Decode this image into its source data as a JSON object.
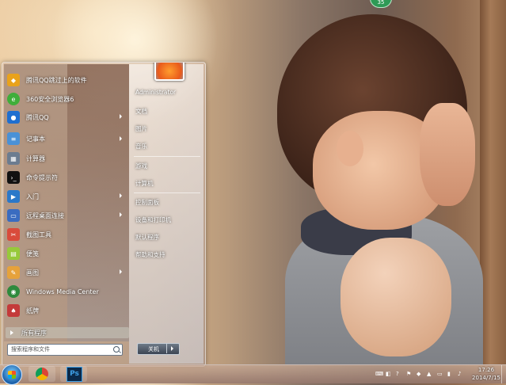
{
  "desktop": {
    "badge": "35"
  },
  "start_menu": {
    "programs": [
      {
        "label": "腾讯QQ跳过上的软件",
        "icon": "qq-icon",
        "color": "#e9a21b"
      },
      {
        "label": "360安全浏览器6",
        "icon": "browser-360-icon",
        "color": "#3fae3a"
      },
      {
        "label": "腾讯QQ",
        "icon": "qq-penguin-icon",
        "color": "#1f6fd0"
      },
      {
        "label": "记事本",
        "icon": "notepad-icon",
        "color": "#4a91d6"
      },
      {
        "label": "计算器",
        "icon": "calculator-icon",
        "color": "#6b7c90"
      },
      {
        "label": "命令提示符",
        "icon": "cmd-icon",
        "color": "#111111"
      },
      {
        "label": "入门",
        "icon": "getting-started-icon",
        "color": "#2b78c9"
      },
      {
        "label": "远程桌面连接",
        "icon": "remote-desktop-icon",
        "color": "#3a6cc0"
      },
      {
        "label": "截图工具",
        "icon": "snipping-tool-icon",
        "color": "#d94b3b"
      },
      {
        "label": "便笺",
        "icon": "sticky-notes-icon",
        "color": "#97c93a"
      },
      {
        "label": "画图",
        "icon": "paint-icon",
        "color": "#e6a23b"
      },
      {
        "label": "Windows Media Center",
        "icon": "media-center-icon",
        "color": "#2f8a3d"
      },
      {
        "label": "纸牌",
        "icon": "solitaire-icon",
        "color": "#c43a3a"
      }
    ],
    "all_programs": "所有程序",
    "search_placeholder": "搜索程序和文件",
    "user": "Administrator",
    "right_items": [
      "文档",
      "图片",
      "音乐",
      "游戏",
      "计算机",
      "控制面板",
      "设备和打印机",
      "默认程序",
      "帮助和支持"
    ],
    "shutdown": "关机"
  },
  "taskbar": {
    "time": "17:26",
    "date": "2014/7/15",
    "tray_icons": [
      "keyboard-icon",
      "ime-icon",
      "help-icon",
      "network-icon",
      "shield-icon",
      "flag-icon",
      "battery-icon",
      "signal-icon",
      "volume-icon"
    ]
  }
}
